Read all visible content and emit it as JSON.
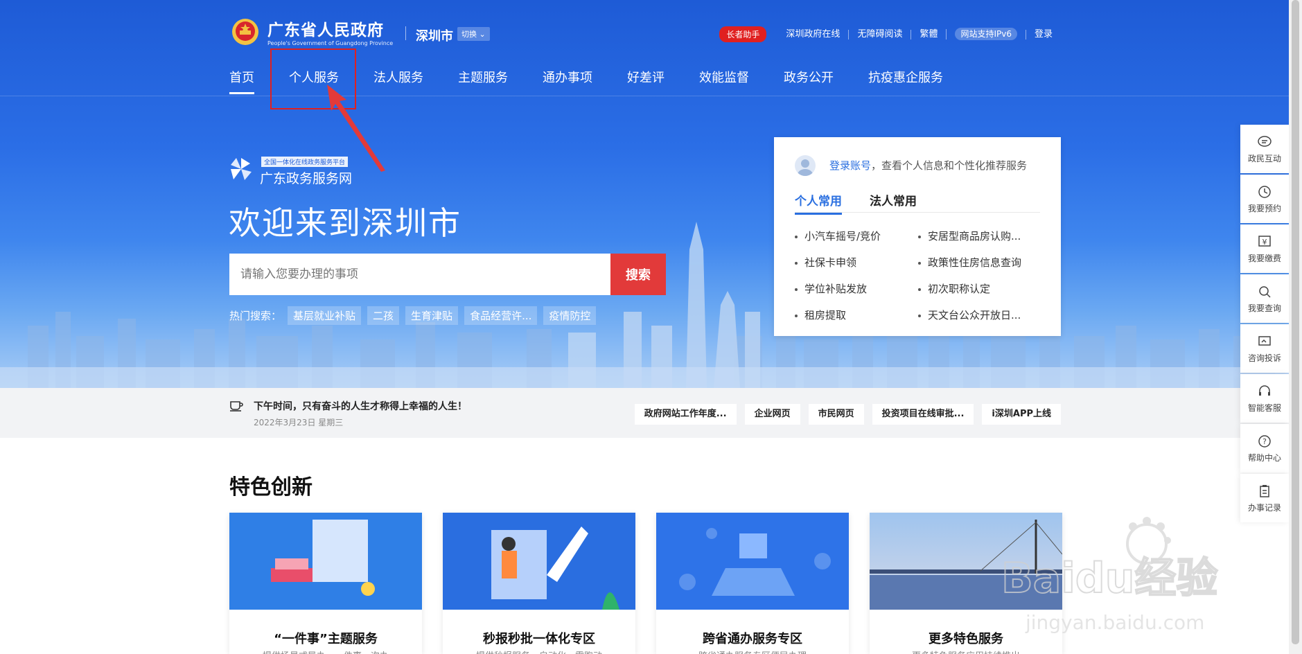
{
  "header": {
    "gov_title": "广东省人民政府",
    "gov_subtitle": "People's Government of Guangdong Province",
    "city": "深圳市",
    "switch_label": "切换",
    "top_links": {
      "elder": "长者助手",
      "online": "深圳政府在线",
      "accessible": "无障碍阅读",
      "traditional": "繁體",
      "ipv6": "网站支持IPv6",
      "login": "登录"
    }
  },
  "nav": {
    "items": [
      "首页",
      "个人服务",
      "法人服务",
      "主题服务",
      "通办事项",
      "好差评",
      "效能监督",
      "政务公开",
      "抗疫惠企服务"
    ]
  },
  "hero": {
    "platform_tag": "全国一体化在线政务服务平台",
    "platform_name": "广东政务服务网",
    "welcome": "欢迎来到深圳市",
    "search_placeholder": "请输入您要办理的事项",
    "search_button": "搜索",
    "hot_label": "热门搜索：",
    "hot_tags": [
      "基层就业补贴",
      "二孩",
      "生育津贴",
      "食品经营许...",
      "疫情防控"
    ]
  },
  "login_card": {
    "login_link": "登录账号",
    "login_text": "，查看个人信息和个性化推荐服务",
    "tabs": [
      "个人常用",
      "法人常用"
    ],
    "services_left": [
      "小汽车摇号/竞价",
      "社保卡申领",
      "学位补贴发放",
      "租房提取"
    ],
    "services_right": [
      "安居型商品房认购...",
      "政策性住房信息查询",
      "初次职称认定",
      "天文台公众开放日..."
    ]
  },
  "notice": {
    "message": "下午时间，只有奋斗的人生才称得上幸福的人生！",
    "date": "2022年3月23日 星期三",
    "quick_links": [
      "政府网站工作年度...",
      "企业网页",
      "市民网页",
      "投资项目在线审批...",
      "i深圳APP上线"
    ]
  },
  "features": {
    "title": "特色创新",
    "cards": [
      {
        "title": "“一件事”主题服务",
        "desc": "提供场景式导办，一件事一次办"
      },
      {
        "title": "秒报秒批一体化专区",
        "desc": "提供秒报服务，自动化、零跑动"
      },
      {
        "title": "跨省通办服务专区",
        "desc": "跨省通办服务专区便民办理"
      },
      {
        "title": "更多特色服务",
        "desc": "更多特色服务应用持续推出"
      }
    ]
  },
  "sidebar": {
    "items": [
      "政民互动",
      "我要预约",
      "我要缴费",
      "我要查询",
      "咨询投诉",
      "智能客服",
      "帮助中心",
      "办事记录"
    ]
  },
  "watermark": {
    "text": "Baidu经验",
    "sub": "jingyan.baidu.com"
  },
  "colors": {
    "brand_blue": "#1e5bd6",
    "accent_red": "#e23a3a",
    "link_blue": "#2a6fe0"
  }
}
